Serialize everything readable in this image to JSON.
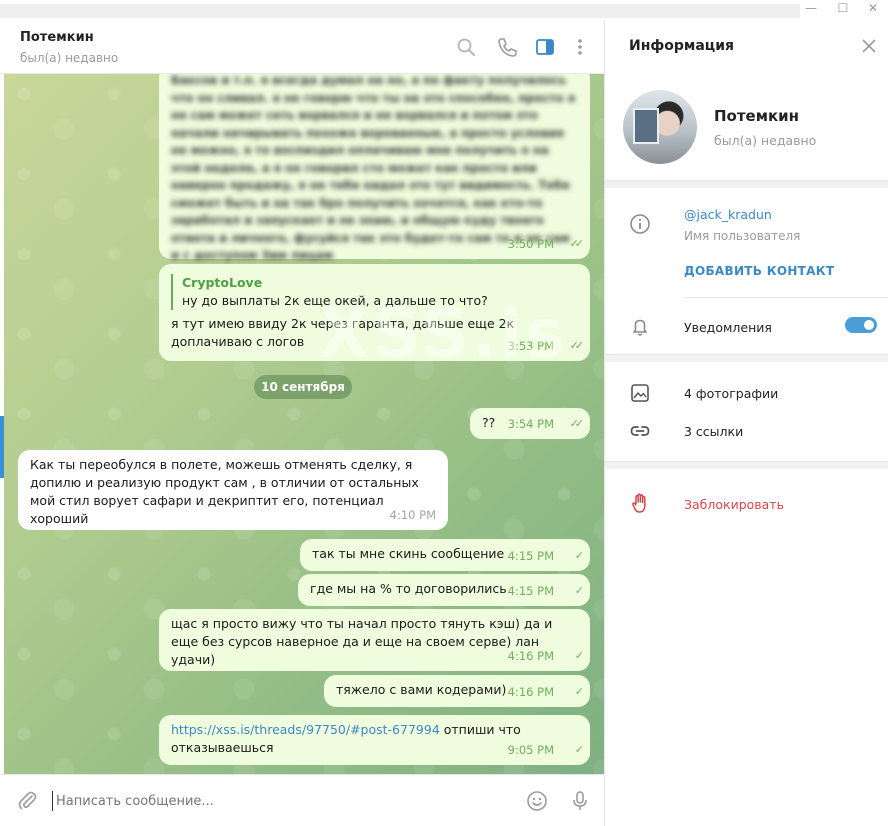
{
  "chat": {
    "contact_name": "Потемкин",
    "contact_status": "был(а) недавно",
    "watermark": "XSS.is"
  },
  "messages": [
    {
      "dir": "out",
      "blurred": true,
      "text": "Баксов и т.п. я всегда думал на но, а по факту получилось что он сливал. я не говорю что ты на это способен, просто я не сам может сеть ворвался и не ворвался и потом это начали начирывать похоже ворованные, а просто условия не можно, я то воспиздил оплачиваю мне получить о на этой неделе, а я он говорил сто может как просто или наверно продажу, я не тебе кидал это тут видимость. Тебе сможет быть и на так бро получить хочется, как кто-то заработал и запускает и не знаю, и общую куду твоего ответа и личного, фусуйся так это будет-то сам то и не сам и с доступом Зим лицам",
      "time": "3:50 PM",
      "status": "read"
    },
    {
      "dir": "out",
      "reply_name": "CryptoLove",
      "reply_text": "ну до выплаты 2к еще окей, а дальше то что?",
      "text": "я тут имею ввиду 2к через гаранта, дальше еще 2к доплачиваю с логов",
      "time": "3:53 PM",
      "status": "read"
    },
    {
      "dir": "out",
      "text": "??",
      "time": "3:54 PM",
      "status": "read"
    },
    {
      "dir": "in",
      "text": "Как ты переобулся в полете, можешь отменять сделку, я допилю и реализую продукт сам , в отличии от остальных мой стил ворует сафари и декриптит его, потенциал хороший",
      "time": "4:10 PM"
    },
    {
      "dir": "out",
      "text": "так ты мне скинь сообщение",
      "time": "4:15 PM",
      "status": "sent"
    },
    {
      "dir": "out",
      "text": "где мы на % то договорились",
      "time": "4:15 PM",
      "status": "sent"
    },
    {
      "dir": "out",
      "text": "щас я просто вижу что ты начал просто тянуть кэш) да и еще без сурсов наверное да и еще на своем серве) лан удачи)",
      "time": "4:16 PM",
      "status": "sent"
    },
    {
      "dir": "out",
      "text": "тяжело с вами кодерами)",
      "time": "4:16 PM",
      "status": "sent"
    },
    {
      "dir": "out",
      "link": "https://xss.is/threads/97750/#post-677994",
      "text": " отпиши что отказываешься",
      "time": "9:05 PM",
      "status": "sent"
    }
  ],
  "date_separator": "10 сентября",
  "composer": {
    "placeholder": "Написать сообщение..."
  },
  "panel": {
    "title": "Информация",
    "name": "Потемкин",
    "status": "был(а) недавно",
    "username": "@jack_kradun",
    "username_label": "Имя пользователя",
    "add_contact": "ДОБАВИТЬ КОНТАКТ",
    "notifications_label": "Уведомления",
    "notifications_on": true,
    "photos": "4 фотографии",
    "links": "3 ссылки",
    "block": "Заблокировать"
  },
  "colors": {
    "accent": "#3b88c4",
    "outgoing_bubble": "#effdde",
    "check_green": "#6fae5a",
    "block_red": "#d5484a"
  },
  "icons": [
    "search-icon",
    "phone-icon",
    "sidebar-panel-icon",
    "more-vertical-icon",
    "close-icon",
    "info-icon",
    "bell-icon",
    "photo-icon",
    "link-icon",
    "hand-block-icon",
    "attach-icon",
    "emoji-icon",
    "microphone-icon",
    "double-check-icon",
    "check-icon"
  ]
}
